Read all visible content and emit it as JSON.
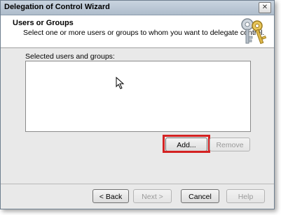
{
  "window": {
    "title": "Delegation of Control Wizard",
    "close_glyph": "✕"
  },
  "header": {
    "title": "Users or Groups",
    "subtitle": "Select one or more users or groups to whom you want to delegate control.",
    "icon": "keys-icon"
  },
  "list": {
    "label": "Selected users and groups:",
    "items": []
  },
  "buttons": {
    "add": "Add...",
    "remove": "Remove",
    "back": "< Back",
    "next": "Next >",
    "cancel": "Cancel",
    "help": "Help"
  },
  "colors": {
    "highlight": "#d42222",
    "title_bar": "#b8c6d5"
  }
}
